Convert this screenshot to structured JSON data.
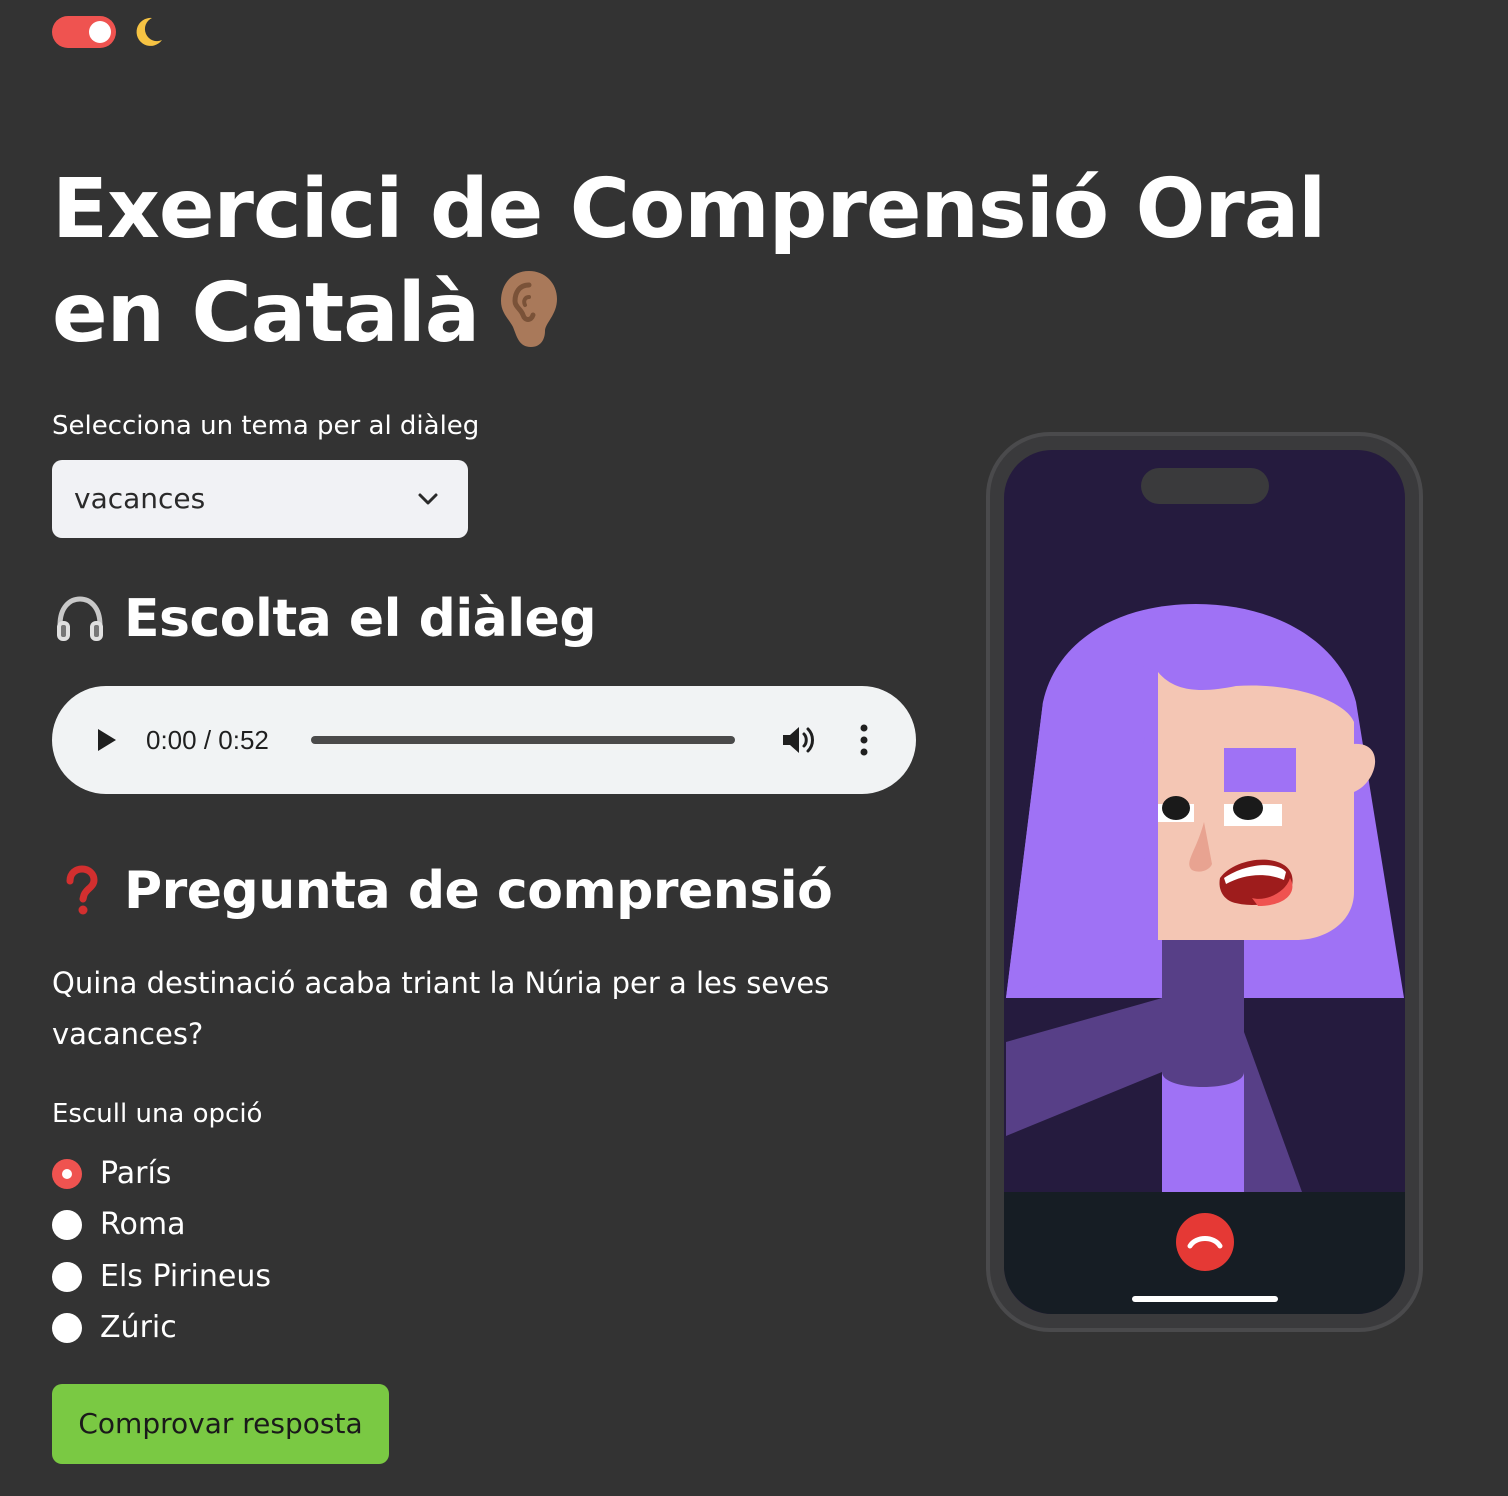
{
  "theme_toggle": {
    "state": "on",
    "icon": "moon-icon",
    "color": "#ef5350"
  },
  "page": {
    "title": "Exercici de Comprensió Oral en Català",
    "title_icon": "ear-icon"
  },
  "topic_select": {
    "label": "Selecciona un tema per al diàleg",
    "value": "vacances"
  },
  "listen_section": {
    "heading": "Escolta el diàleg",
    "icon": "headphones-icon"
  },
  "audio_player": {
    "time": "0:00 / 0:52",
    "progress": 0
  },
  "question_section": {
    "heading": "Pregunta de comprensió",
    "icon": "question-mark-icon",
    "question": "Quina destinació acaba triant la Núria per a les seves vacances?"
  },
  "options": {
    "label": "Escull una opció",
    "items": [
      "París",
      "Roma",
      "Els Pirineus",
      "Zúric"
    ],
    "selected_index": 0
  },
  "submit_button": {
    "label": "Comprovar resposta",
    "color": "#7ac943"
  },
  "illustration": {
    "type": "phone video call",
    "icons": [
      "phone-hangup-icon"
    ],
    "colors": {
      "hair": "#9f72f5",
      "skin": "#f4c6b4",
      "screen": "#251b3e",
      "hangup": "#e53935"
    }
  }
}
